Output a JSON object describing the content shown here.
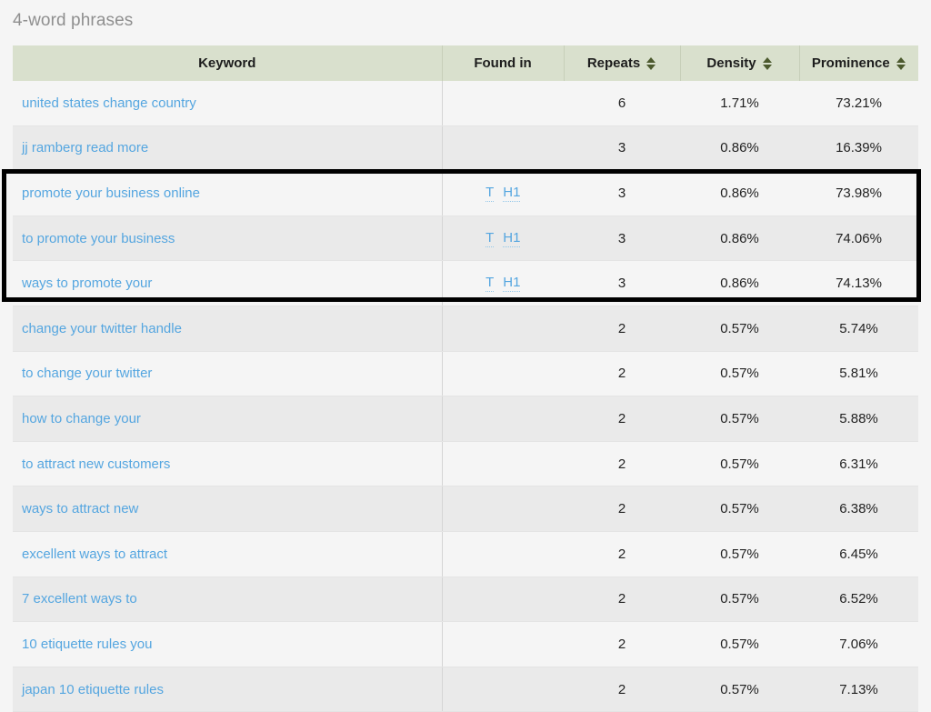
{
  "section": {
    "title": "4-word phrases"
  },
  "table": {
    "columns": [
      {
        "key": "keyword",
        "label": "Keyword",
        "sortable": false
      },
      {
        "key": "found_in",
        "label": "Found in",
        "sortable": false
      },
      {
        "key": "repeats",
        "label": "Repeats",
        "sortable": true,
        "sort_icon": "sort-updown-icon"
      },
      {
        "key": "density",
        "label": "Density",
        "sortable": true,
        "sort_icon": "sort-updown-icon"
      },
      {
        "key": "prominence",
        "label": "Prominence",
        "sortable": true,
        "sort_icon": "sort-updown-icon"
      }
    ],
    "rows": [
      {
        "keyword": "united states change country",
        "found_in": [],
        "repeats": "6",
        "density": "1.71%",
        "prominence": "73.21%",
        "highlighted": false
      },
      {
        "keyword": "jj ramberg read more",
        "found_in": [],
        "repeats": "3",
        "density": "0.86%",
        "prominence": "16.39%",
        "highlighted": false
      },
      {
        "keyword": "promote your business online",
        "found_in": [
          "T",
          "H1"
        ],
        "repeats": "3",
        "density": "0.86%",
        "prominence": "73.98%",
        "highlighted": true
      },
      {
        "keyword": "to promote your business",
        "found_in": [
          "T",
          "H1"
        ],
        "repeats": "3",
        "density": "0.86%",
        "prominence": "74.06%",
        "highlighted": true
      },
      {
        "keyword": "ways to promote your",
        "found_in": [
          "T",
          "H1"
        ],
        "repeats": "3",
        "density": "0.86%",
        "prominence": "74.13%",
        "highlighted": true
      },
      {
        "keyword": "change your twitter handle",
        "found_in": [],
        "repeats": "2",
        "density": "0.57%",
        "prominence": "5.74%",
        "highlighted": false
      },
      {
        "keyword": "to change your twitter",
        "found_in": [],
        "repeats": "2",
        "density": "0.57%",
        "prominence": "5.81%",
        "highlighted": false
      },
      {
        "keyword": "how to change your",
        "found_in": [],
        "repeats": "2",
        "density": "0.57%",
        "prominence": "5.88%",
        "highlighted": false
      },
      {
        "keyword": "to attract new customers",
        "found_in": [],
        "repeats": "2",
        "density": "0.57%",
        "prominence": "6.31%",
        "highlighted": false
      },
      {
        "keyword": "ways to attract new",
        "found_in": [],
        "repeats": "2",
        "density": "0.57%",
        "prominence": "6.38%",
        "highlighted": false
      },
      {
        "keyword": "excellent ways to attract",
        "found_in": [],
        "repeats": "2",
        "density": "0.57%",
        "prominence": "6.45%",
        "highlighted": false
      },
      {
        "keyword": "7 excellent ways to",
        "found_in": [],
        "repeats": "2",
        "density": "0.57%",
        "prominence": "6.52%",
        "highlighted": false
      },
      {
        "keyword": "10 etiquette rules you",
        "found_in": [],
        "repeats": "2",
        "density": "0.57%",
        "prominence": "7.06%",
        "highlighted": false
      },
      {
        "keyword": "japan 10 etiquette rules",
        "found_in": [],
        "repeats": "2",
        "density": "0.57%",
        "prominence": "7.13%",
        "highlighted": false
      }
    ]
  },
  "annotation": {
    "highlight_box": {
      "color": "#000000",
      "rows": [
        "promote your business online",
        "to promote your business",
        "ways to promote your"
      ]
    }
  },
  "colors": {
    "page_background": "#f5f5f5",
    "header_background": "#d9e0cd",
    "row_odd": "#f5f5f5",
    "row_even": "#eaeaea",
    "link": "#55a6e0",
    "title_text": "#8f8f8f",
    "sort_arrow": "#4c5a2e"
  }
}
